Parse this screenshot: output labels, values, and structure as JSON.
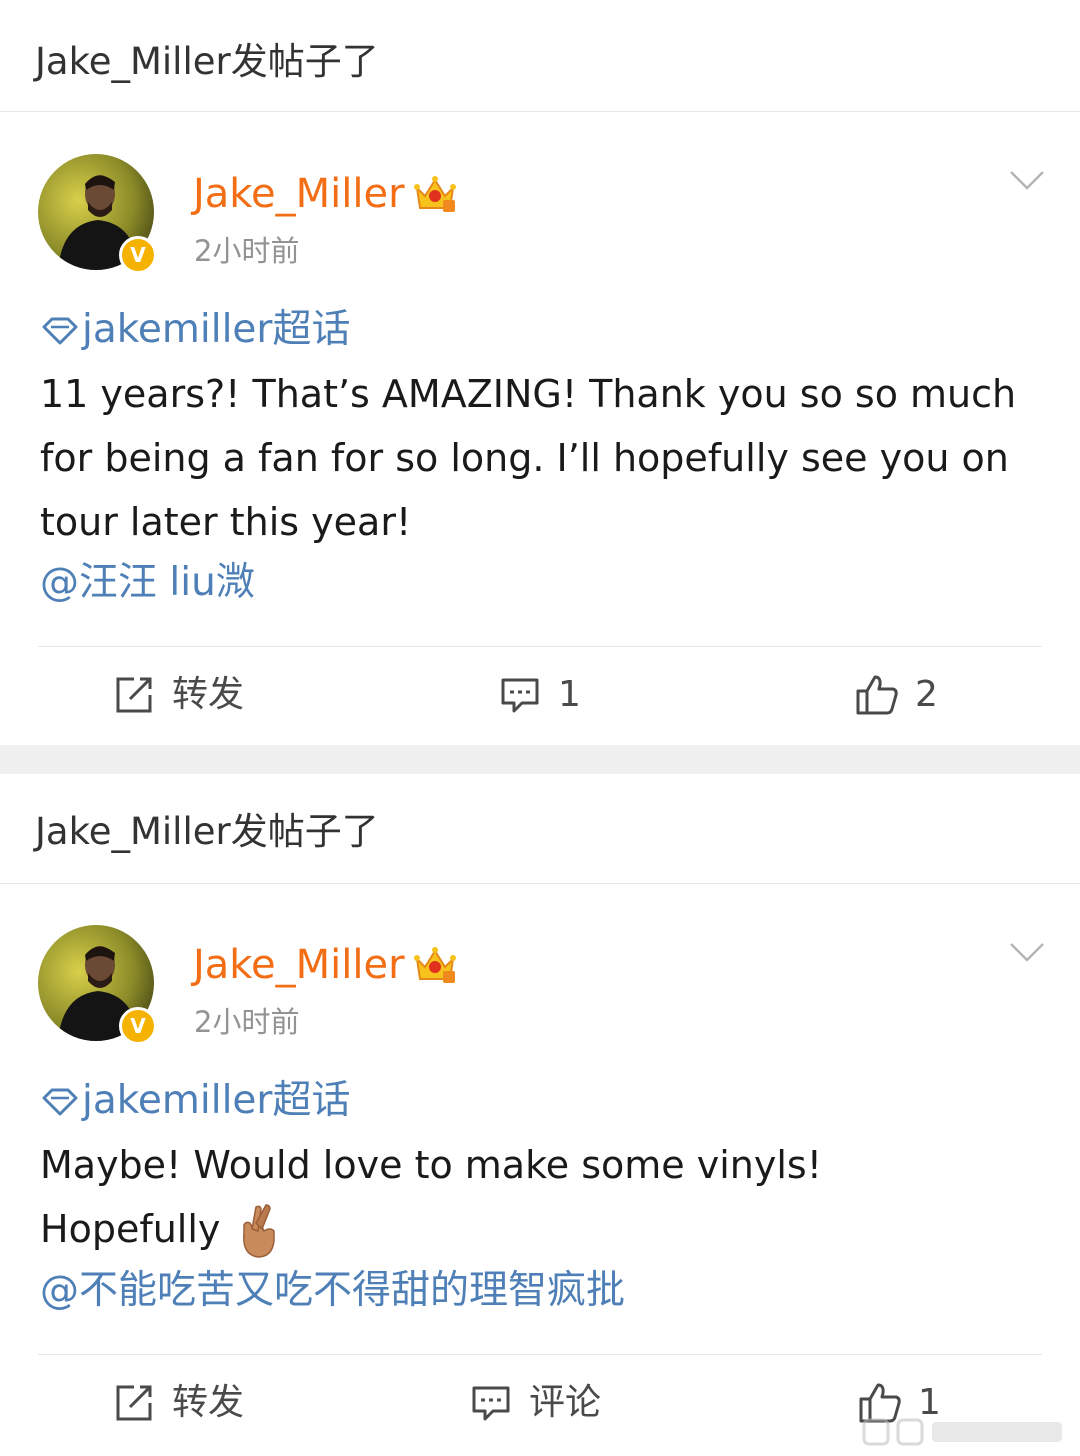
{
  "posts": [
    {
      "header": "Jake_Miller发帖子了",
      "username": "Jake_Miller",
      "verified_mark": "V",
      "timestamp": "2小时前",
      "topic": "jakemiller超话",
      "text": "11 years?! That’s AMAZING! Thank you so so much for being a fan for so long. I’ll hopefully see you on tour later this year!",
      "mention": "@汪汪 liu溦",
      "actions": {
        "repost_label": "转发",
        "comment_label": "1",
        "like_label": "2"
      },
      "icons": [
        "crown-badge-icon",
        "chevron-down-icon",
        "diamond-topic-icon",
        "share-edit-icon",
        "comment-icon",
        "thumbs-up-icon"
      ]
    },
    {
      "header": "Jake_Miller发帖子了",
      "username": "Jake_Miller",
      "verified_mark": "V",
      "timestamp": "2小时前",
      "topic": "jakemiller超话",
      "text": "Maybe! Would love to make some vinyls!\nHopefully",
      "emoji": "crossed-fingers-emoji",
      "mention": "@不能吃苦又吃不得甜的理智疯批",
      "actions": {
        "repost_label": "转发",
        "comment_label": "评论",
        "like_label": "1"
      },
      "icons": [
        "crown-badge-icon",
        "chevron-down-icon",
        "diamond-topic-icon",
        "share-edit-icon",
        "comment-icon",
        "thumbs-up-icon"
      ]
    }
  ],
  "colors": {
    "username": "#f26d14",
    "link": "#4e7fb6",
    "timestamp": "#939393",
    "verified": "#f5b300",
    "separator": "#f0f0f0"
  }
}
